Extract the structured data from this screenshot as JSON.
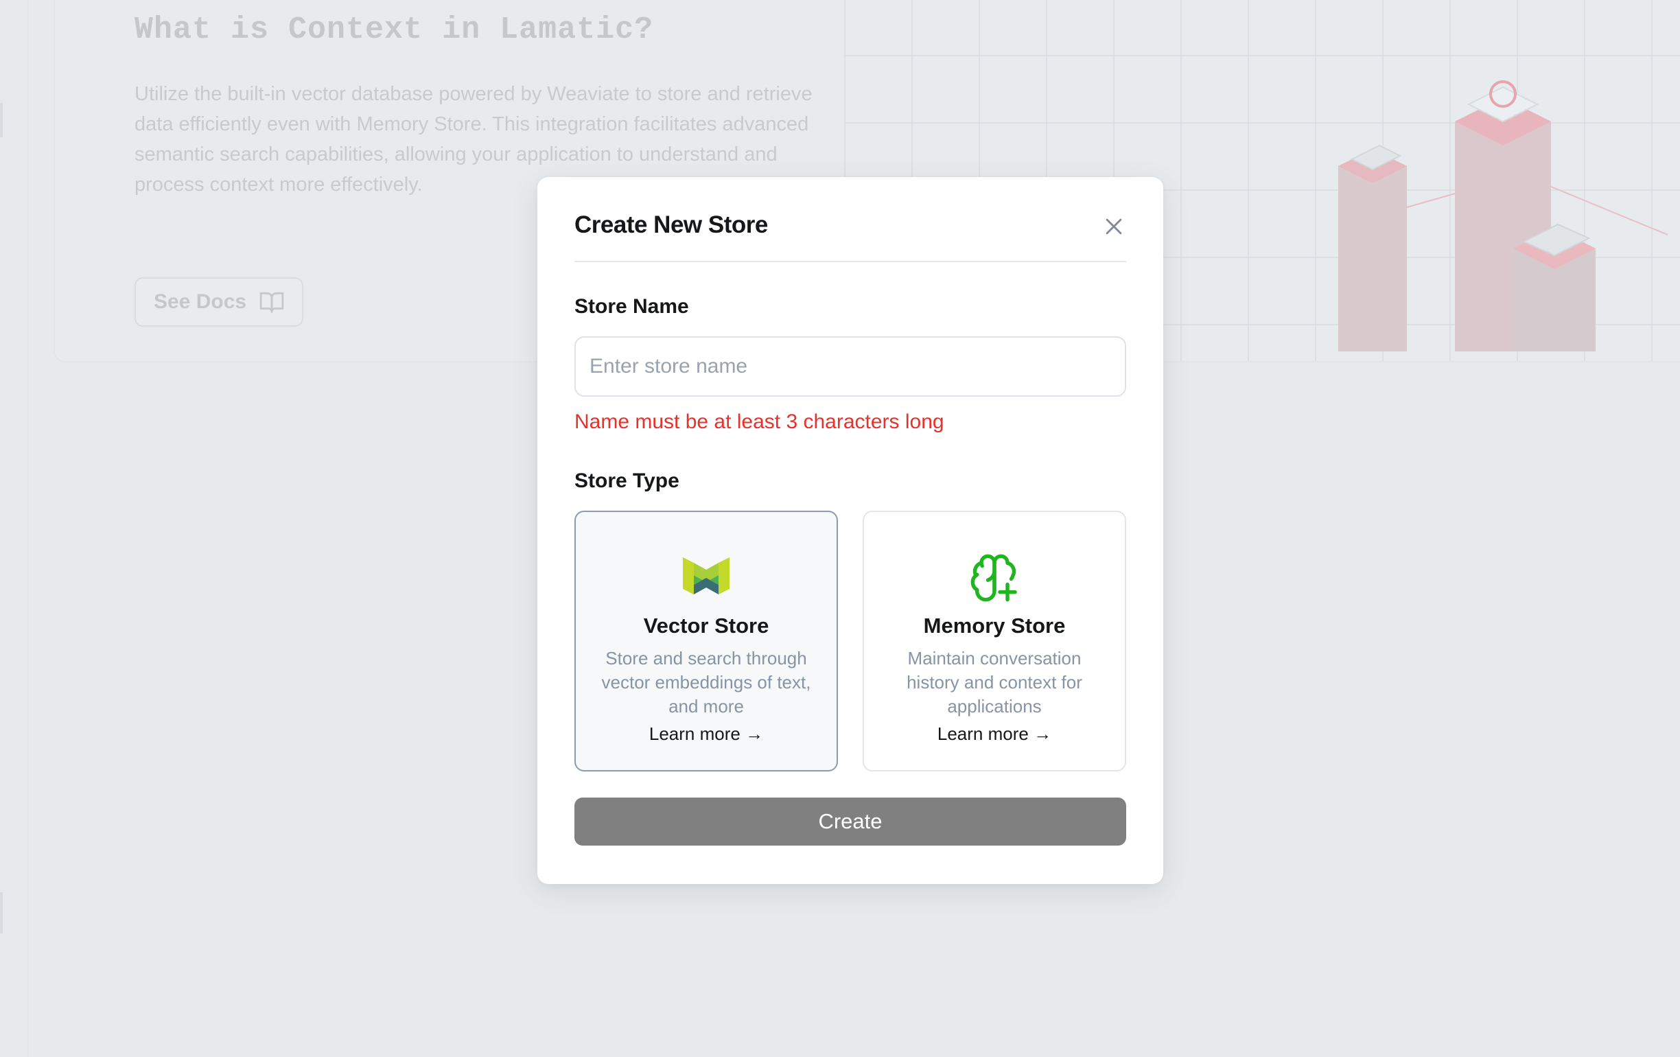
{
  "background": {
    "info_card": {
      "title": "What is Context in Lamatic?",
      "description": "Utilize the built-in vector database powered by Weaviate to store and retrieve data efficiently even with Memory Store. This integration facilitates advanced semantic search capabilities, allowing your application to understand and process context more effectively.",
      "docs_button_label": "See Docs",
      "docs_icon": "book-open-icon"
    }
  },
  "modal": {
    "title": "Create New Store",
    "close_icon": "close-icon",
    "store_name": {
      "label": "Store Name",
      "placeholder": "Enter store name",
      "value": "",
      "error": "Name must be at least 3 characters long"
    },
    "store_type": {
      "label": "Store Type",
      "selected": "vector",
      "options": [
        {
          "id": "vector",
          "icon": "weaviate-logo-icon",
          "title": "Vector Store",
          "description": "Store and search through vector embeddings of text, and more",
          "link": "Learn more"
        },
        {
          "id": "memory",
          "icon": "brain-plus-icon",
          "title": "Memory Store",
          "description": "Maintain conversation history and context for applications",
          "link": "Learn more"
        }
      ]
    },
    "create_button_label": "Create",
    "create_button_disabled": true
  },
  "colors": {
    "error": "#e5322d",
    "memory_icon": "#1fb51f",
    "disabled_button": "#808080",
    "selected_card_border": "#8c9bb0"
  }
}
